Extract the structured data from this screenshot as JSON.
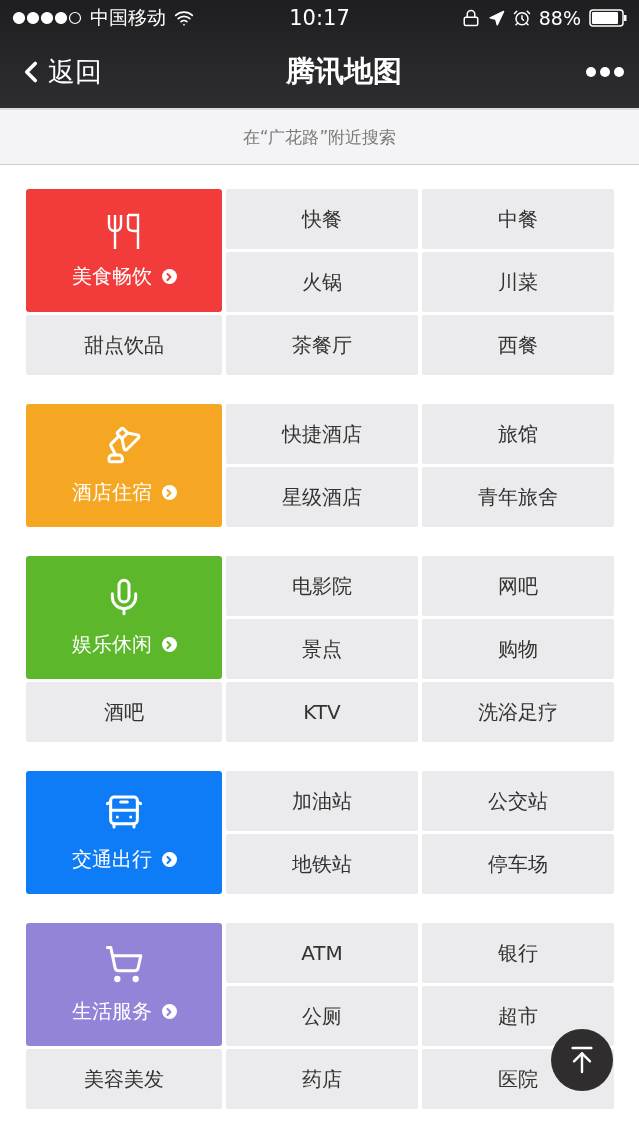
{
  "status_bar": {
    "carrier": "中国移动",
    "time": "10:17",
    "battery": "88%"
  },
  "nav_bar": {
    "back": "返回",
    "title": "腾讯地图"
  },
  "search_hint": "在“广花路”附近搜索",
  "groups": [
    {
      "category": {
        "label": "美食畅饮",
        "color": "#f23c3c",
        "kind": "utensils"
      },
      "items": [
        "快餐",
        "中餐",
        "火锅",
        "川菜",
        "甜点饮品",
        "茶餐厅",
        "西餐"
      ]
    },
    {
      "category": {
        "label": "酒店住宿",
        "color": "#f5a623",
        "kind": "lamp"
      },
      "items": [
        "快捷酒店",
        "旅馆",
        "星级酒店",
        "青年旅舍"
      ]
    },
    {
      "category": {
        "label": "娱乐休闲",
        "color": "#5cb82a",
        "kind": "mic"
      },
      "items": [
        "电影院",
        "网吧",
        "景点",
        "购物",
        "酒吧",
        "KTV",
        "洗浴足疗"
      ]
    },
    {
      "category": {
        "label": "交通出行",
        "color": "#0f7cf7",
        "kind": "bus"
      },
      "items": [
        "加油站",
        "公交站",
        "地铁站",
        "停车场"
      ]
    },
    {
      "category": {
        "label": "生活服务",
        "color": "#9384d8",
        "kind": "cart"
      },
      "items": [
        "ATM",
        "银行",
        "公厕",
        "超市",
        "美容美发",
        "药店",
        "医院"
      ]
    }
  ]
}
